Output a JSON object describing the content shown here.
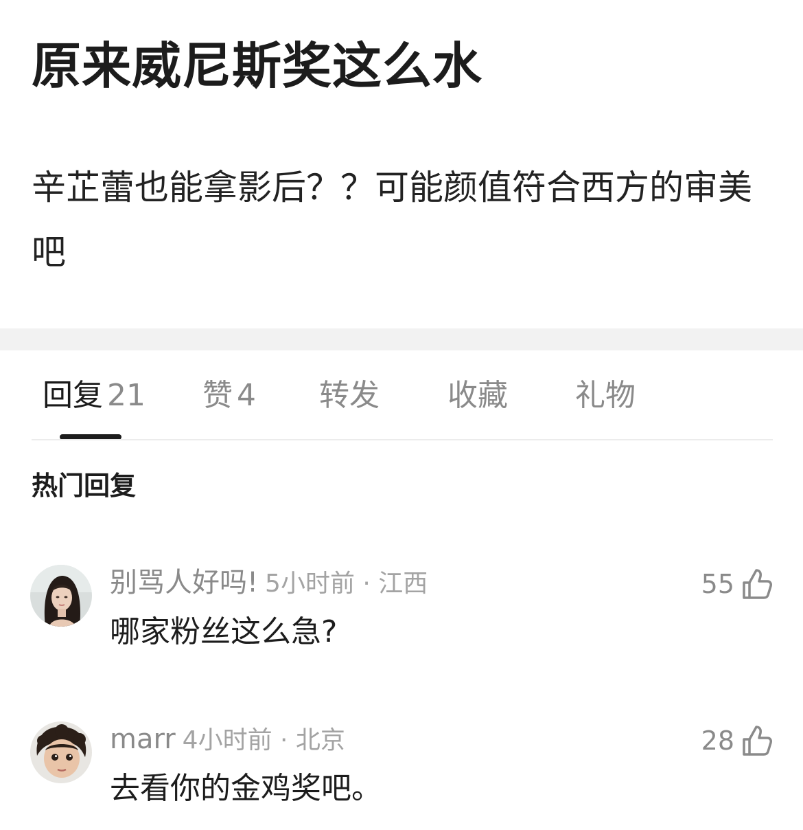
{
  "post": {
    "title": "原来威尼斯奖这么水",
    "body": "辛芷蕾也能拿影后？？可能颜值符合西方的审美吧"
  },
  "tabs": [
    {
      "label": "回复",
      "count": "21",
      "active": true
    },
    {
      "label": "赞",
      "count": "4",
      "active": false
    },
    {
      "label": "转发",
      "count": "",
      "active": false
    },
    {
      "label": "收藏",
      "count": "",
      "active": false
    },
    {
      "label": "礼物",
      "count": "",
      "active": false
    }
  ],
  "section": {
    "heading": "热门回复"
  },
  "comments": [
    {
      "user": "别骂人好吗!",
      "time_location": "5小时前 · 江西",
      "text": "哪家粉丝这么急?",
      "likes": "55",
      "avatar": "woman-portrait-avatar"
    },
    {
      "user": "marr",
      "time_location": "4小时前 · 北京",
      "text": "去看你的金鸡奖吧。",
      "likes": "28",
      "avatar": "child-portrait-avatar"
    }
  ],
  "icons": {
    "like": "thumbs-up-icon"
  },
  "colors": {
    "text_primary": "#1c1c1c",
    "text_secondary": "#8a8a8a",
    "divider": "#f2f2f2",
    "indicator": "#1c1c1c"
  }
}
